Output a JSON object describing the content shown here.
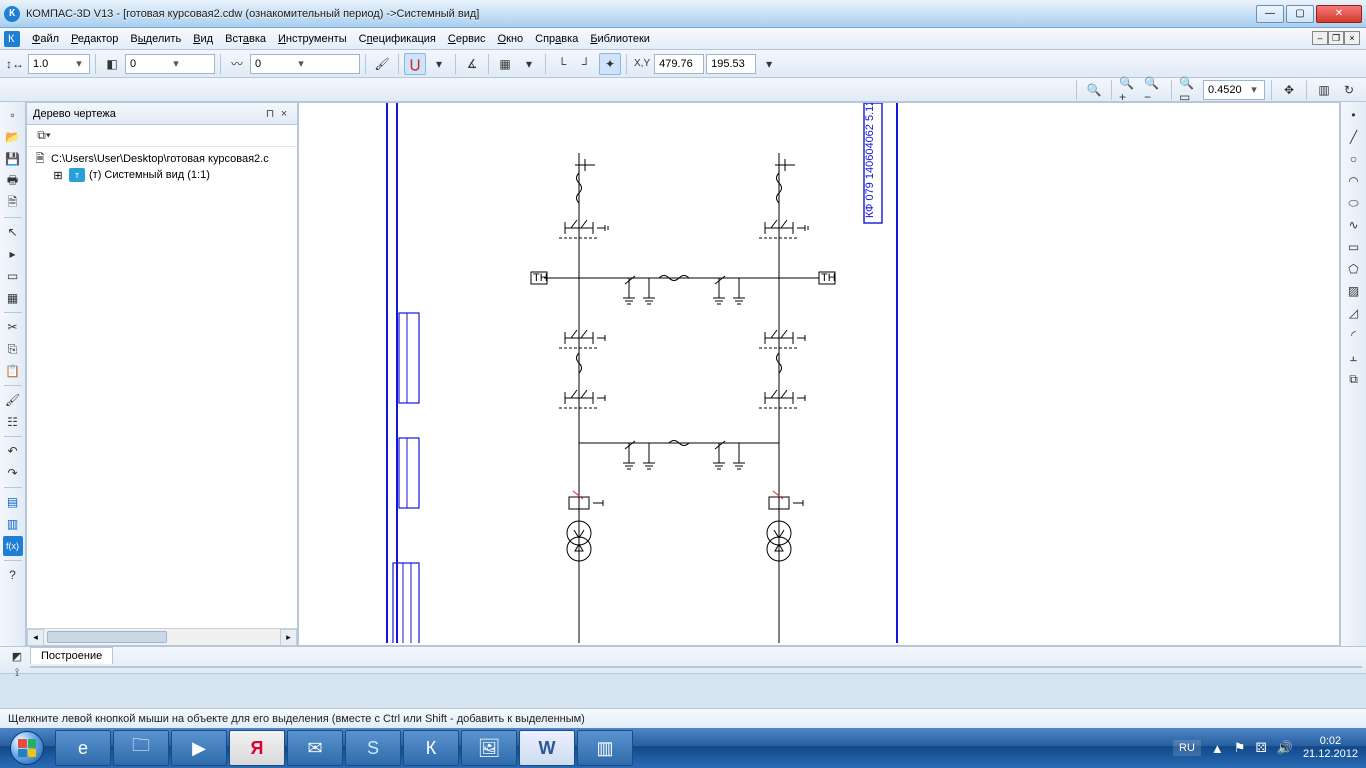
{
  "title": "КОМПАС-3D V13 - [готовая курсовая2.cdw (ознакомительный период) ->Системный вид]",
  "menu": [
    "Файл",
    "Редактор",
    "Выделить",
    "Вид",
    "Вставка",
    "Инструменты",
    "Спецификация",
    "Сервис",
    "Окно",
    "Справка",
    "Библиотеки"
  ],
  "toolbar": {
    "scale": "1.0",
    "layer_num": "0",
    "style_num": "0",
    "coord_x": "479.76",
    "coord_y": "195.53",
    "zoom": "0.4520"
  },
  "tree": {
    "title": "Дерево чертежа",
    "file": "C:\\Users\\User\\Desktop\\готовая курсовая2.c",
    "view": "(т) Системный вид (1:1)"
  },
  "bottom_tab": "Построение",
  "status": "Щелкните левой кнопкой мыши на объекте для его выделения (вместе с Ctrl или Shift - добавить к выделенным)",
  "taskbar": {
    "lang": "RU",
    "time": "0:02",
    "date": "21.12.2012"
  },
  "glyphs": {
    "xy": "X,Y",
    "tn": "ТН"
  }
}
